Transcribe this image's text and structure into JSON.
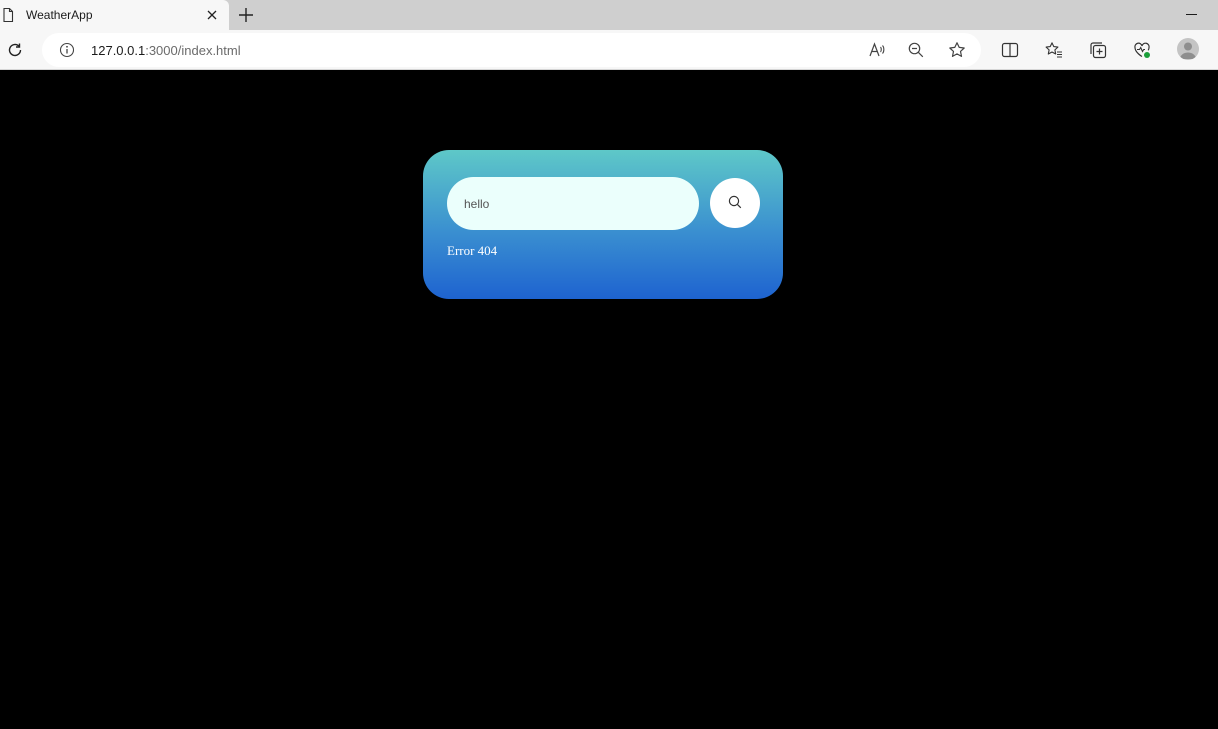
{
  "browser": {
    "tab": {
      "title": "WeatherApp"
    },
    "address": {
      "host": "127.0.0.1",
      "path": ":3000/index.html"
    }
  },
  "page": {
    "search": {
      "value": "hello"
    },
    "status_message": "Error 404"
  },
  "colors": {
    "page_background": "#000000",
    "card_gradient_top": "#5ec8c8",
    "card_gradient_bottom": "#1e63d0",
    "input_background": "#ebfffc"
  }
}
